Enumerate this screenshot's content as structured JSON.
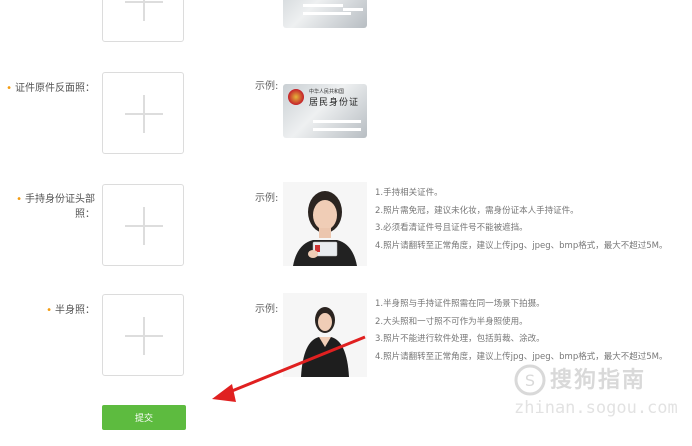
{
  "rows": [
    {
      "label": "证件原件反面照：",
      "example_label": "示例:"
    },
    {
      "label": "手持身份证头部照：",
      "example_label": "示例:",
      "tips": [
        "1.手持相关证件。",
        "2.照片需免冠，建议未化妆，需身份证本人手持证件。",
        "3.必须看清证件号且证件号不能被遮挡。",
        "4.照片请翻转至正常角度，建议上传jpg、jpeg、bmp格式，最大不超过5M。"
      ]
    },
    {
      "label": "半身照：",
      "example_label": "示例:",
      "tips": [
        "1.半身照与手持证件照需在同一场景下拍摄。",
        "2.大头照和一寸照不可作为半身照使用。",
        "3.照片不能进行软件处理，包括剪裁、涂改。",
        "4.照片请翻转至正常角度，建议上传jpg、jpeg、bmp格式，最大不超过5M。"
      ]
    }
  ],
  "id_card": {
    "line1": "中华人民共和国",
    "line2": "居民身份证"
  },
  "submit_label": "提交",
  "watermark": {
    "text": "搜狗指南",
    "url": "zhinan.sogou.com"
  },
  "colors": {
    "accent": "#5dbb3f",
    "required": "#f39c12",
    "arrow": "#e02020"
  }
}
